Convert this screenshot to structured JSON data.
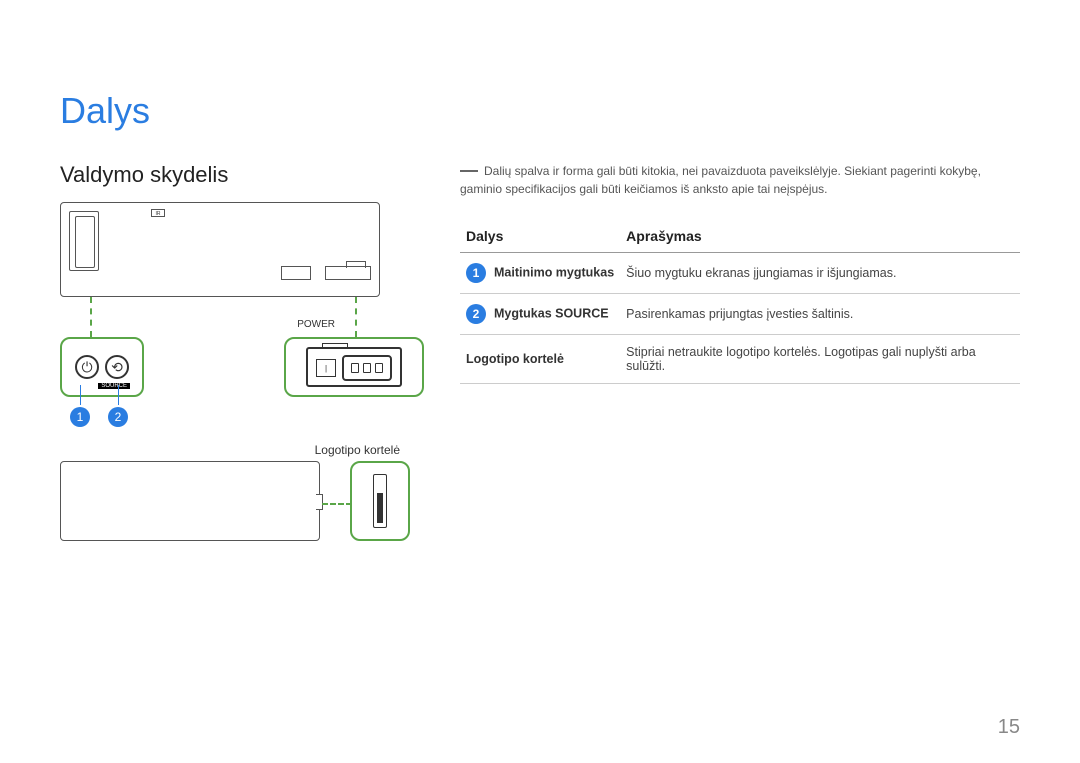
{
  "page_title": "Dalys",
  "section_title": "Valdymo skydelis",
  "ir_label": "IR",
  "power_label": "POWER",
  "source_label": "SOURCE",
  "switch_mark": "|",
  "badges": {
    "b1": "1",
    "b2": "2"
  },
  "logo_label": "Logotipo kortelė",
  "note": "Dalių spalva ir forma gali būti kitokia, nei pavaizduota paveikslėlyje. Siekiant pagerinti kokybę, gaminio specifikacijos gali būti keičiamos iš anksto apie tai neįspėjus.",
  "table": {
    "headers": {
      "part": "Dalys",
      "desc": "Aprašymas"
    },
    "rows": [
      {
        "badge": "1",
        "name": "Maitinimo mygtukas",
        "desc": "Šiuo mygtuku ekranas įjungiamas ir išjungiamas."
      },
      {
        "badge": "2",
        "name": "Mygtukas SOURCE",
        "desc": "Pasirenkamas prijungtas įvesties šaltinis."
      },
      {
        "badge": "",
        "name": "Logotipo kortelė",
        "desc": "Stipriai netraukite logotipo kortelės. Logotipas gali nuplyšti arba sulūžti."
      }
    ]
  },
  "page_number": "15"
}
